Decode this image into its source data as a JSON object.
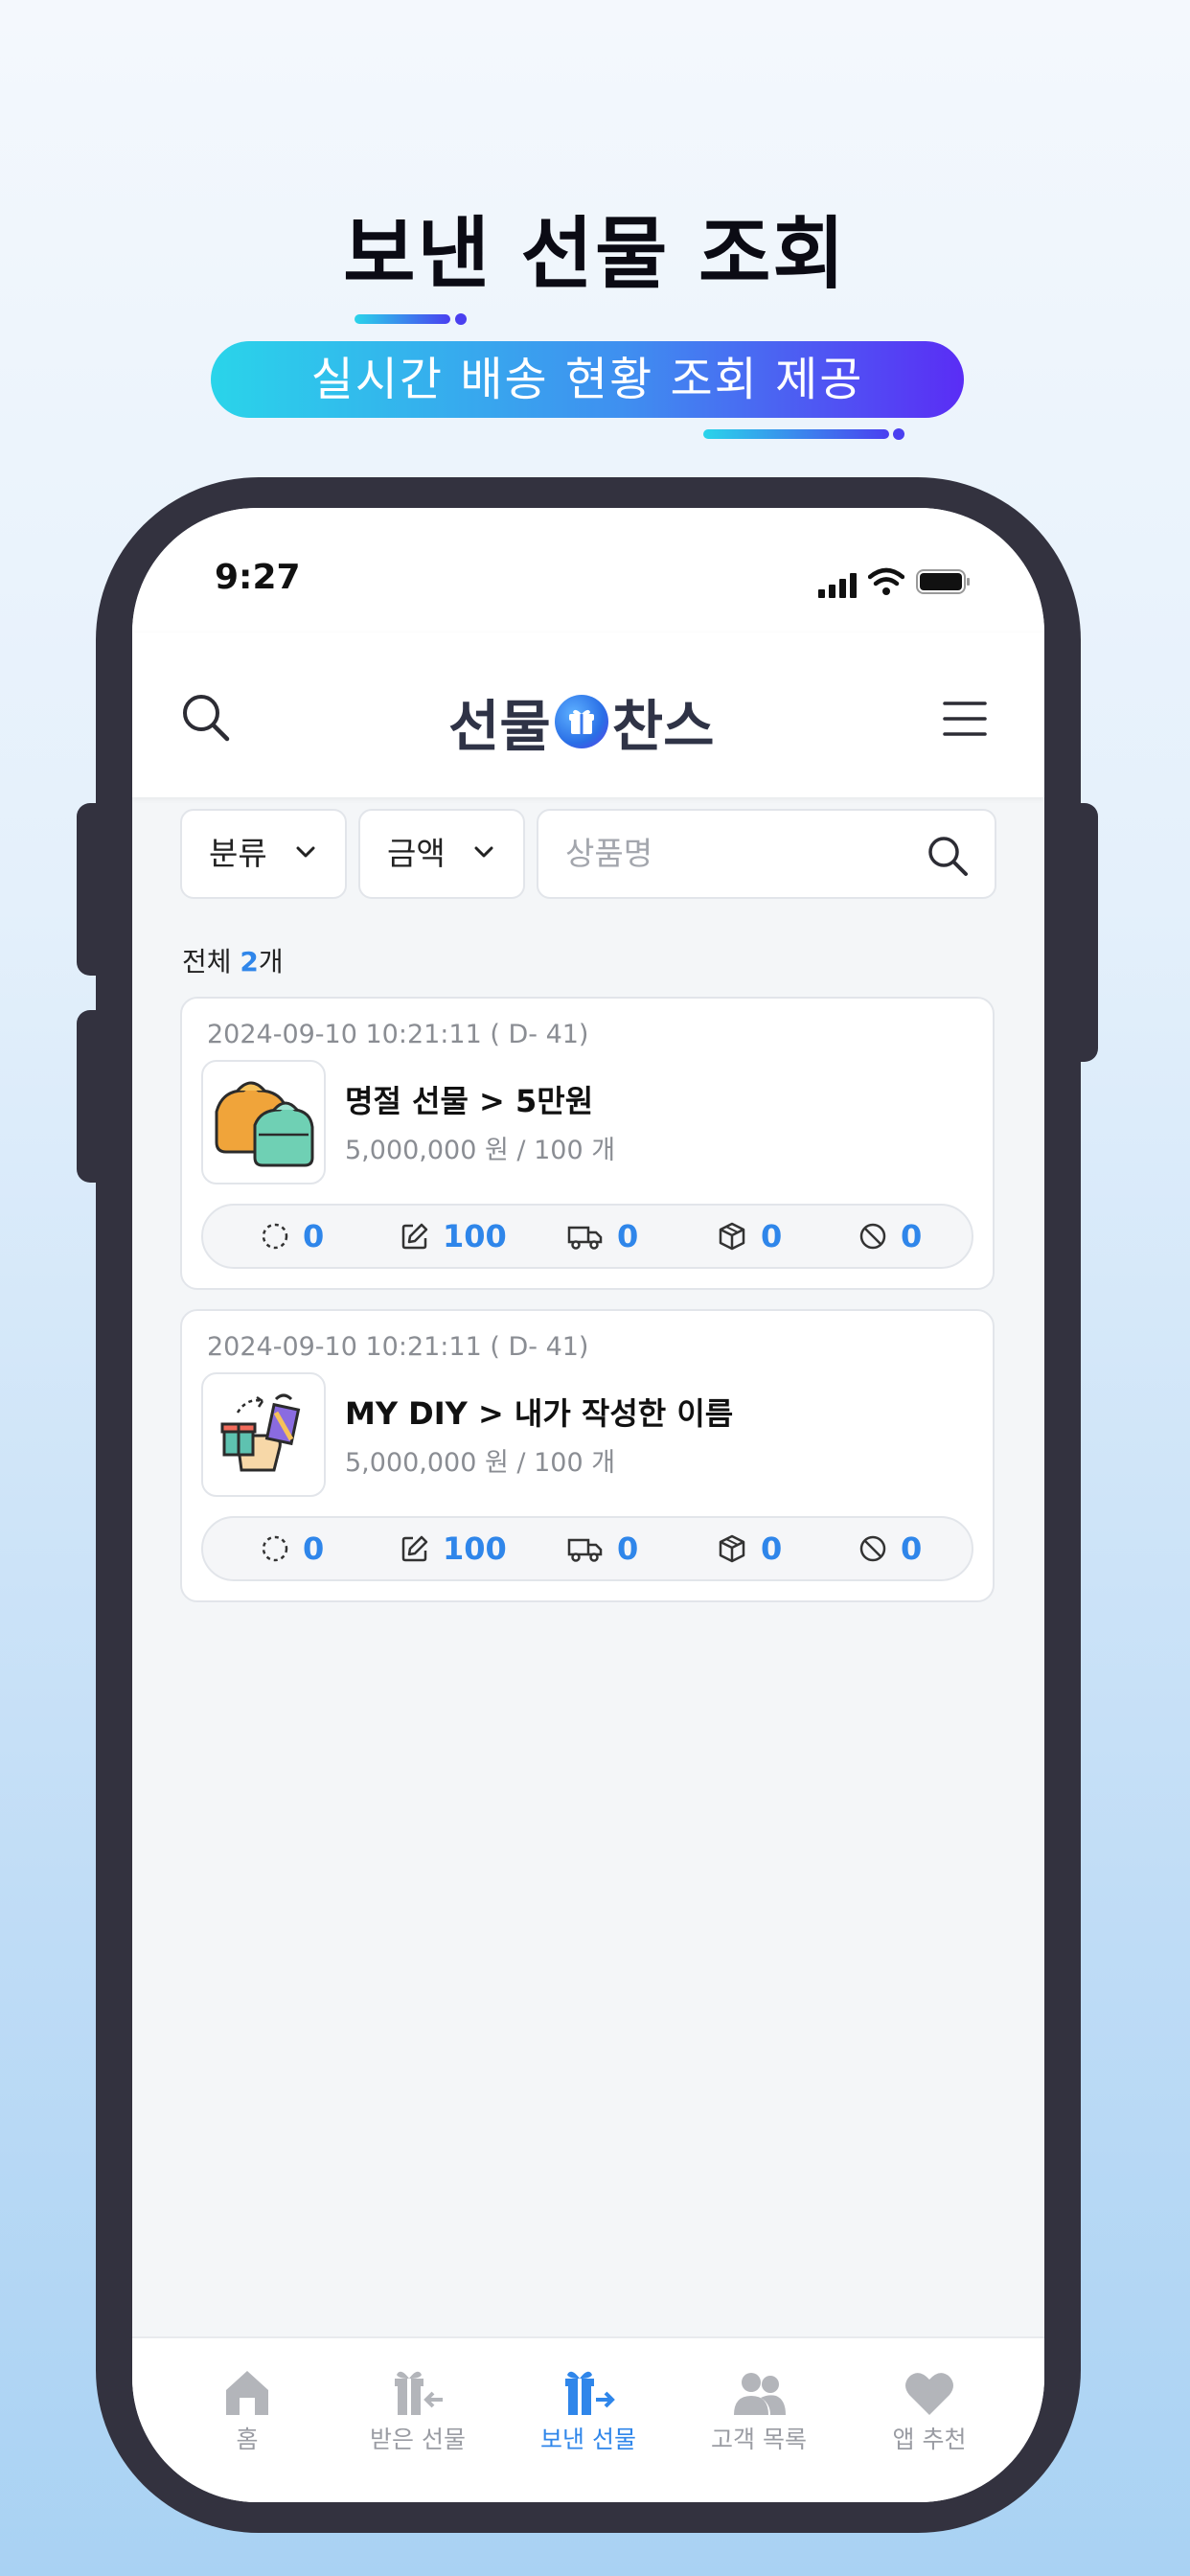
{
  "promo": {
    "headline": "보낸 선물 조회",
    "banner": "실시간 배송 현황 조회 제공"
  },
  "status_bar": {
    "time": "9:27"
  },
  "header": {
    "logo_left": "선물",
    "logo_right": "찬스"
  },
  "filters": {
    "category_label": "분류",
    "amount_label": "금액",
    "search_placeholder": "상품명"
  },
  "summary": {
    "total_prefix": "전체 ",
    "total_count": "2",
    "total_suffix": "개"
  },
  "orders": [
    {
      "date": "2024-09-10 10:21:11 ( D- 41)",
      "title": "명절 선물 > 5만원",
      "price_qty": "5,000,000 원 / 100 개",
      "thumbnail_icon": "gift-bundle-icon",
      "stats": {
        "pending": "0",
        "written": "100",
        "shipping": "0",
        "delivered": "0",
        "cancelled": "0"
      }
    },
    {
      "date": "2024-09-10 10:21:11 ( D- 41)",
      "title": "MY DIY > 내가 작성한 이름",
      "price_qty": "5,000,000 원 / 100 개",
      "thumbnail_icon": "gift-exchange-icon",
      "stats": {
        "pending": "0",
        "written": "100",
        "shipping": "0",
        "delivered": "0",
        "cancelled": "0"
      }
    }
  ],
  "tabbar": {
    "items": [
      {
        "label": "홈",
        "icon": "home-icon"
      },
      {
        "label": "받은 선물",
        "icon": "received-gift-icon"
      },
      {
        "label": "보낸 선물",
        "icon": "sent-gift-icon",
        "active": true
      },
      {
        "label": "고객 목록",
        "icon": "customers-icon"
      },
      {
        "label": "앱 추천",
        "icon": "heart-icon"
      }
    ]
  },
  "colors": {
    "accent": "#2f86ea",
    "frame": "#33323f",
    "banner_start": "#2ad4ea",
    "banner_end": "#5a2df5"
  }
}
